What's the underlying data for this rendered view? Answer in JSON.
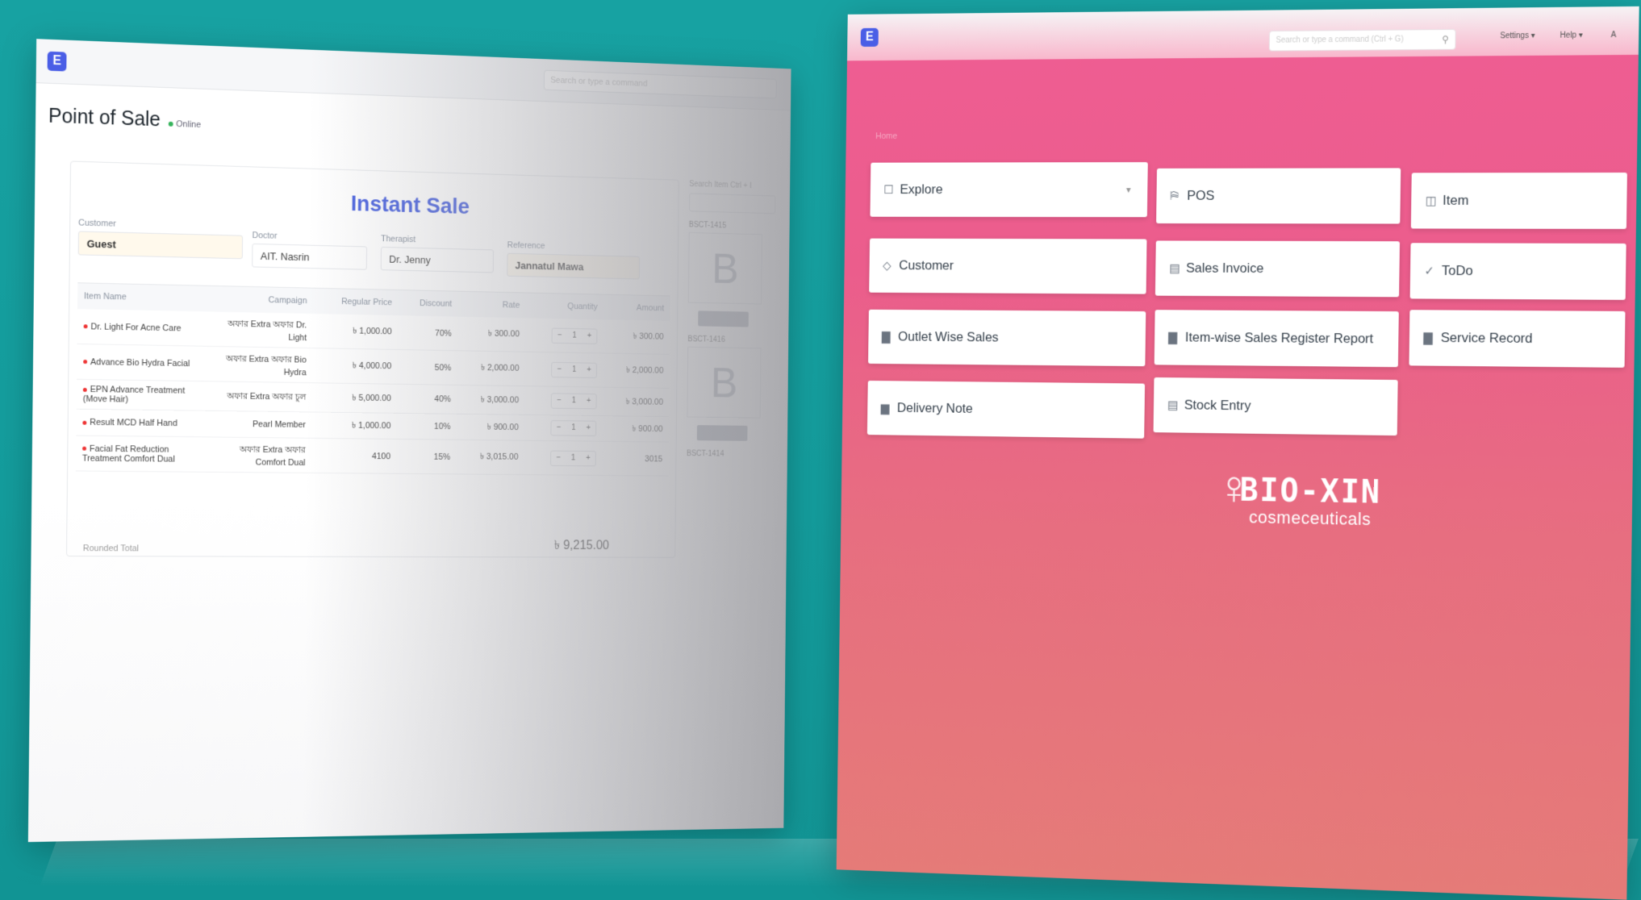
{
  "left_window": {
    "app_logo": "E",
    "search_placeholder": "Search or type a command",
    "page_title": "Point of Sale",
    "status": "Online",
    "instant_title": "Instant Sale",
    "fields": {
      "customer": {
        "label": "Customer",
        "value": "Guest"
      },
      "doctor": {
        "label": "Doctor",
        "value": "AIT. Nasrin"
      },
      "therapist": {
        "label": "Therapist",
        "value": "Dr. Jenny"
      },
      "reference": {
        "label": "Reference",
        "value": "Jannatul Mawa"
      }
    },
    "table": {
      "headers": [
        "Item Name",
        "Campaign",
        "Regular Price",
        "Discount",
        "Rate",
        "Quantity",
        "Amount"
      ],
      "rows": [
        {
          "name": "Dr. Light For Acne Care",
          "campaign": "অফার Extra অফার Dr. Light",
          "regular": "৳ 1,000.00",
          "discount": "70%",
          "rate": "৳ 300.00",
          "qty": "1",
          "amount": "৳ 300.00"
        },
        {
          "name": "Advance Bio Hydra Facial",
          "campaign": "অফার Extra অফার Bio Hydra",
          "regular": "৳ 4,000.00",
          "discount": "50%",
          "rate": "৳ 2,000.00",
          "qty": "1",
          "amount": "৳ 2,000.00"
        },
        {
          "name": "EPN Advance Treatment (Move Hair)",
          "campaign": "অফার Extra অফার চুল",
          "regular": "৳ 5,000.00",
          "discount": "40%",
          "rate": "৳ 3,000.00",
          "qty": "1",
          "amount": "৳ 3,000.00"
        },
        {
          "name": "Result MCD Half Hand",
          "campaign": "Pearl Member",
          "regular": "৳ 1,000.00",
          "discount": "10%",
          "rate": "৳ 900.00",
          "qty": "1",
          "amount": "৳ 900.00"
        },
        {
          "name": "Facial Fat Reduction Treatment Comfort Dual",
          "campaign": "অফার Extra অফার Comfort Dual",
          "regular": "4100",
          "discount": "15%",
          "rate": "৳ 3,015.00",
          "qty": "1",
          "amount": "3015"
        }
      ],
      "qty_minus": "−",
      "qty_plus": "+"
    },
    "rounded_total_label": "Rounded Total",
    "grand_total": "৳ 9,215.00",
    "side": {
      "label": "Search Item Ctrl + I",
      "bills": [
        {
          "id": "BSCT-1415",
          "letter": "B"
        },
        {
          "id": "BSCT-1416",
          "letter": "B"
        },
        {
          "id": "BSCT-1414",
          "letter": ""
        }
      ]
    }
  },
  "right_window": {
    "app_logo": "E",
    "search_placeholder": "Search or type a command (Ctrl + G)",
    "settings_label": "Settings",
    "help_label": "Help",
    "avatar_letter": "A",
    "workspace_label": "Home",
    "tiles": [
      {
        "label": "Explore",
        "icon": "file-icon",
        "glyph": "☐"
      },
      {
        "label": "POS",
        "icon": "pos-icon",
        "glyph": "⛿"
      },
      {
        "label": "Item",
        "icon": "item-icon",
        "glyph": "◫"
      },
      {
        "label": "Customer",
        "icon": "tag-icon",
        "glyph": "◇"
      },
      {
        "label": "Sales Invoice",
        "icon": "document-icon",
        "glyph": "▤"
      },
      {
        "label": "ToDo",
        "icon": "check-icon",
        "glyph": "✓"
      },
      {
        "label": "Outlet Wise Sales",
        "icon": "folder-icon",
        "glyph": "▇"
      },
      {
        "label": "Item-wise Sales Register Report",
        "icon": "folder-icon",
        "glyph": "▇"
      },
      {
        "label": "Service Record",
        "icon": "folder-icon",
        "glyph": "▇"
      },
      {
        "label": "Delivery Note",
        "icon": "stack-icon",
        "glyph": "▆"
      },
      {
        "label": "Stock Entry",
        "icon": "document-icon",
        "glyph": "▤"
      }
    ],
    "brand": {
      "name": "BIO-XIN",
      "sub": "cosmeceuticals"
    }
  },
  "colors": {
    "background": "#17a2a2",
    "accent_blue": "#4b63e0",
    "pink": "#ec5d8e"
  }
}
